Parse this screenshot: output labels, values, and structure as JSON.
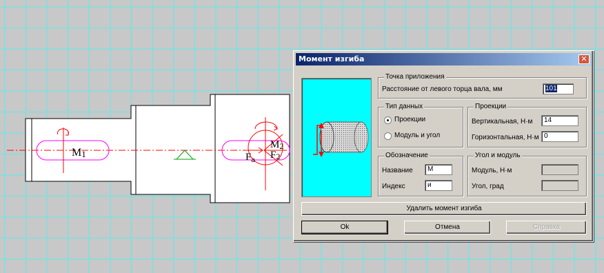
{
  "dialog": {
    "title": "Момент изгиба",
    "close_glyph": "✕",
    "apply_point": {
      "legend": "Точка приложения",
      "distance_label": "Расстояние от левого торца вала, мм",
      "distance_value": "101"
    },
    "data_type": {
      "legend": "Тип данных",
      "option_projections": "Проекции",
      "option_modulus_angle": "Модуль и угол",
      "selected": "Проекции"
    },
    "projections": {
      "legend": "Проекции",
      "vertical_label": "Вертикальная, Н·м",
      "vertical_value": "14",
      "horizontal_label": "Горизонтальная, Н·м",
      "horizontal_value": "0"
    },
    "designation": {
      "legend": "Обозначение",
      "name_label": "Название",
      "name_value": "M",
      "index_label": "Индекс",
      "index_value": "и"
    },
    "angle_modulus": {
      "legend": "Угол и модуль",
      "modulus_label": "Модуль, Н·м",
      "angle_label": "Угол, град"
    },
    "delete_button": "Удалить момент изгиба",
    "ok_button": "Ok",
    "cancel_button": "Отмена",
    "help_button": "Справка"
  },
  "drawing": {
    "labels": {
      "m1": "M",
      "m1_sub": "1",
      "fa": "F",
      "fa_sub": "a",
      "f2": "F",
      "f2_sub": "2",
      "m2": "M",
      "m2_sub": "2"
    }
  },
  "colors": {
    "grid": "#7fdfe0",
    "shaft_outline": "#000000",
    "force": "#ff0000",
    "key_slot": "#ff00ff",
    "support": "#00a000",
    "preview_bg": "#00ffff"
  }
}
